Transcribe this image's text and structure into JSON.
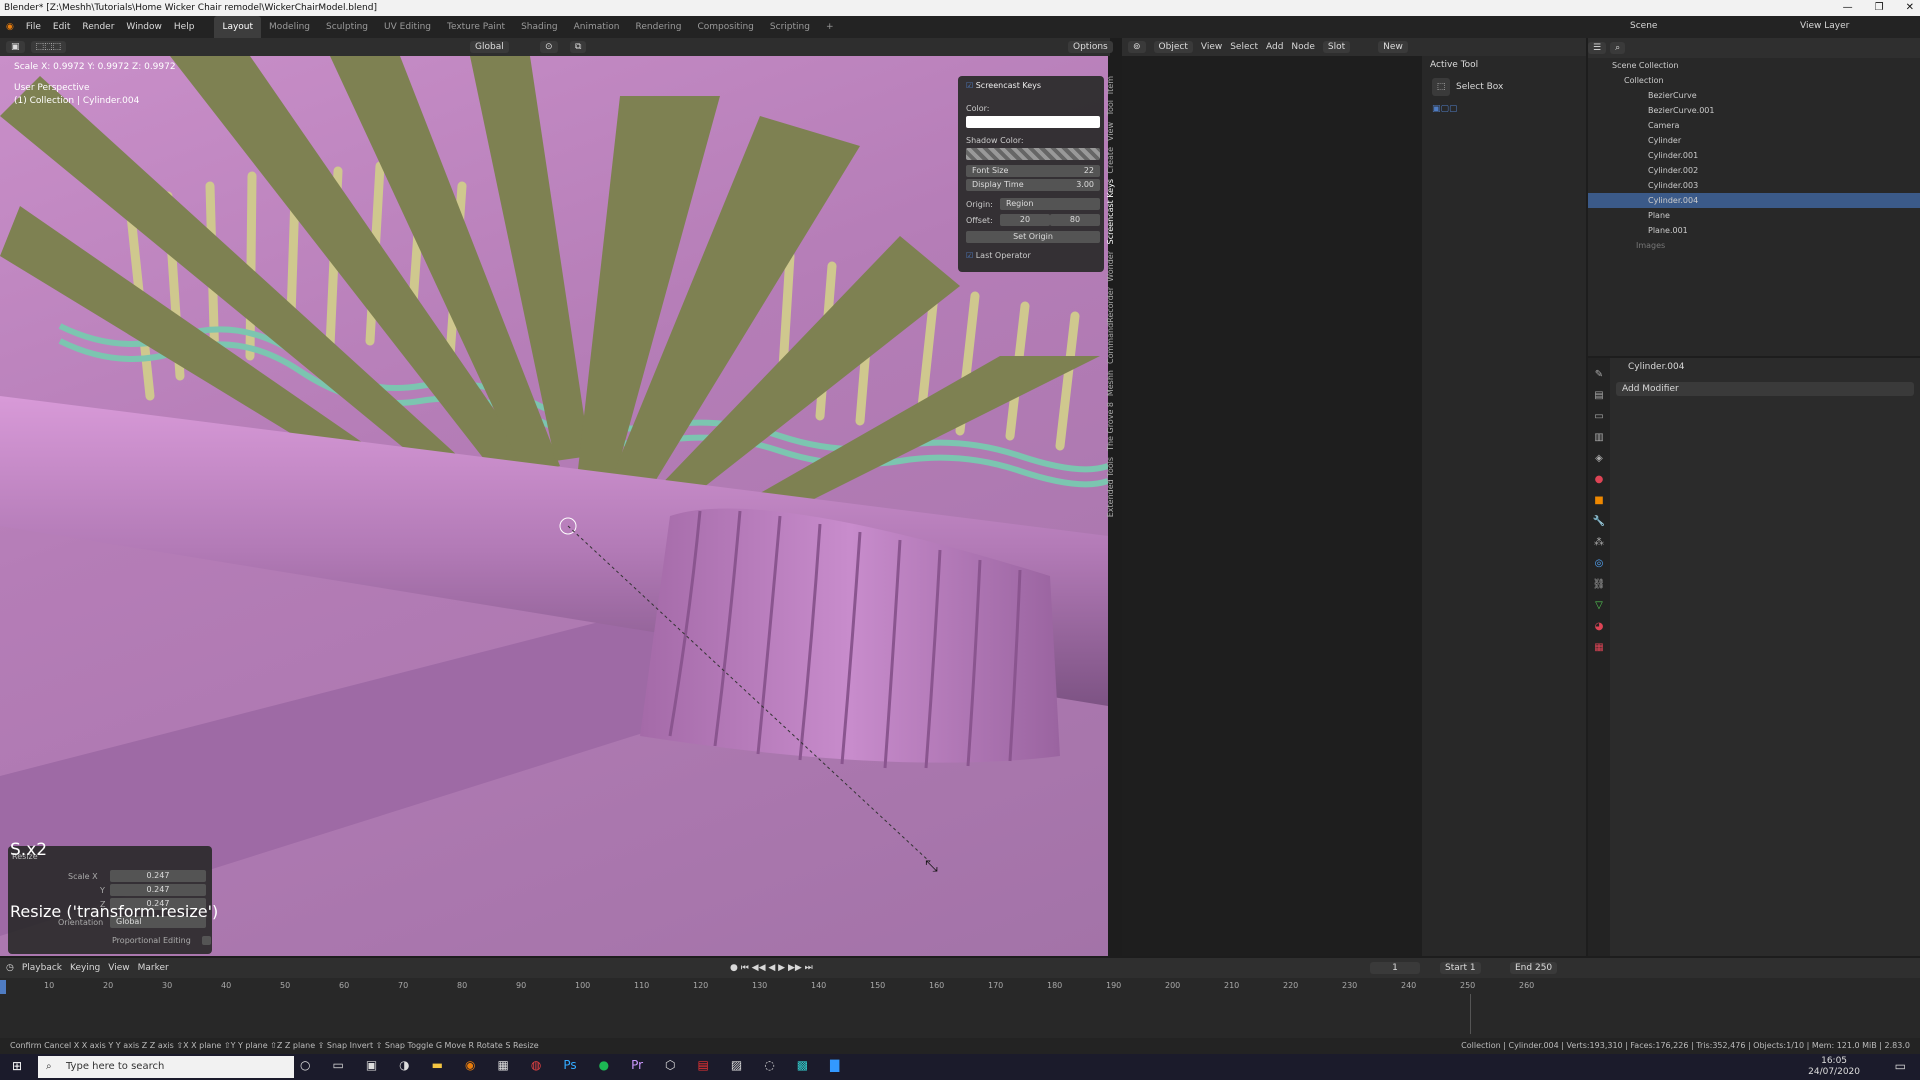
{
  "window": {
    "title": "Blender* [Z:\\Meshh\\Tutorials\\Home Wicker Chair remodel\\WickerChairModel.blend]",
    "controls": [
      "—",
      "❐",
      "✕"
    ]
  },
  "menu": [
    "File",
    "Edit",
    "Render",
    "Window",
    "Help"
  ],
  "workspaces": [
    "Layout",
    "Modeling",
    "Sculpting",
    "UV Editing",
    "Texture Paint",
    "Shading",
    "Animation",
    "Rendering",
    "Compositing",
    "Scripting"
  ],
  "scene_label": "Scene",
  "viewlayer_label": "View Layer",
  "viewport": {
    "orientation": "Global",
    "options": "Options",
    "scale_readout": "Scale X: 0.9972  Y: 0.9972  Z: 0.9972",
    "perspective": "User Perspective",
    "collection_info": "(1) Collection | Cylinder.004",
    "key_hint": "S.x2",
    "operator_hint": "Resize ('transform.resize')"
  },
  "redo_panel": {
    "title": "Resize",
    "fields": [
      {
        "label": "Scale X",
        "value": "0.247"
      },
      {
        "label": "Y",
        "value": "0.247"
      },
      {
        "label": "Z",
        "value": "0.247"
      }
    ],
    "orientation_label": "Orientation",
    "orientation_value": "Global",
    "proportional": "Proportional Editing"
  },
  "screencast": {
    "title": "Screencast Keys",
    "color": "Color:",
    "shadow": "Shadow Color:",
    "font_size_label": "Font Size",
    "font_size": "22",
    "display_time_label": "Display Time",
    "display_time": "3.00",
    "origin_label": "Origin:",
    "origin": "Region",
    "offset_label": "Offset:",
    "offset_x": "20",
    "offset_y": "80",
    "set_origin": "Set Origin",
    "last_operator": "Last Operator"
  },
  "side_tabs": [
    "Item",
    "Tool",
    "View",
    "Create",
    "Screencast Keys",
    "Wonder",
    "CommandRecorder",
    "Meshh",
    "The Grove 8",
    "Extended Tools"
  ],
  "node_header": {
    "object": "Object",
    "view": "View",
    "select": "Select",
    "add": "Add",
    "node": "Node",
    "slot": "Slot",
    "new": "New"
  },
  "active_tool": {
    "title": "Active Tool",
    "tool": "Select Box"
  },
  "outliner": {
    "root": "Scene Collection",
    "collection": "Collection",
    "items": [
      "BezierCurve",
      "BezierCurve.001",
      "Camera",
      "Cylinder",
      "Cylinder.001",
      "Cylinder.002",
      "Cylinder.003",
      "Cylinder.004",
      "Plane",
      "Plane.001"
    ],
    "images": "Images",
    "selected": "Cylinder.004"
  },
  "properties": {
    "object": "Cylinder.004",
    "add_modifier": "Add Modifier"
  },
  "timeline": {
    "menus": [
      "Playback",
      "Keying",
      "View",
      "Marker"
    ],
    "current": "1",
    "start_label": "Start",
    "start": "1",
    "end_label": "End",
    "end": "250",
    "ticks": [
      "10",
      "20",
      "30",
      "40",
      "50",
      "60",
      "70",
      "80",
      "90",
      "100",
      "110",
      "120",
      "130",
      "140",
      "150",
      "160",
      "170",
      "180",
      "190",
      "200",
      "210",
      "220",
      "230",
      "240",
      "250",
      "260"
    ]
  },
  "statusbar": {
    "left": "Confirm  Cancel  X X axis  Y Y axis  Z Z axis  ⇧X X plane  ⇧Y Y plane  ⇧Z Z plane  ⇪ Snap Invert  ⇧ Snap Toggle  G Move  R Rotate  S Resize",
    "right": "Collection | Cylinder.004 | Verts:193,310 | Faces:176,226 | Tris:352,476 | Objects:1/10 | Mem: 121.0 MiB | 2.83.0"
  },
  "taskbar": {
    "search": "Type here to search",
    "time": "16:05",
    "date": "24/07/2020"
  }
}
